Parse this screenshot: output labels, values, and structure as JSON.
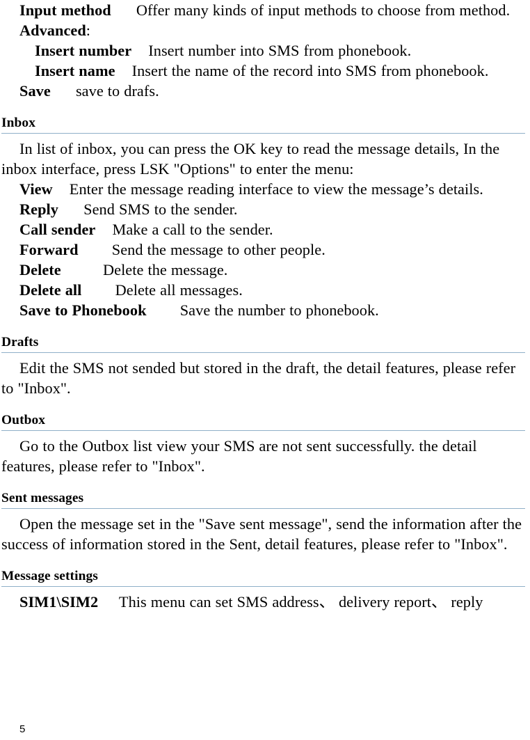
{
  "document": {
    "page_number": "5",
    "rule_color": "#8FAFC8",
    "sections": [
      {
        "id": "compose-options",
        "heading": null,
        "lines": [
          {
            "indent": "indent1",
            "term": "Input method",
            "gap": "      ",
            "text": "Offer many kinds of input methods to choose from method."
          },
          {
            "indent": "indent1",
            "term": "Advanced",
            "gap": "",
            "text": ":"
          },
          {
            "indent": "indent2",
            "term": "Insert number",
            "gap": "    ",
            "text": "Insert number into SMS from phonebook."
          },
          {
            "indent": "indent2",
            "term": "Insert name",
            "gap": "    ",
            "text": "Insert the name of the record into SMS from phonebook."
          },
          {
            "indent": "indent1",
            "term": "Save",
            "gap": "      ",
            "text": "save to drafs."
          }
        ]
      },
      {
        "id": "inbox",
        "heading": "Inbox",
        "lines": [
          {
            "indent": "indent1",
            "term": "",
            "gap": "",
            "text": "In list of inbox, you can press the OK key to read the message details, In the inbox interface, press LSK \"Options\" to enter the menu:"
          },
          {
            "indent": "indent1",
            "term": "View",
            "gap": "    ",
            "text": "Enter the message reading interface to view the message’s details."
          },
          {
            "indent": "indent1",
            "term": "Reply",
            "gap": "      ",
            "text": "Send SMS to the sender."
          },
          {
            "indent": "indent1",
            "term": "Call sender",
            "gap": "    ",
            "text": "Make a call to the sender."
          },
          {
            "indent": "indent1",
            "term": "Forward",
            "gap": "        ",
            "text": "Send the message to other people."
          },
          {
            "indent": "indent1",
            "term": "Delete",
            "gap": "          ",
            "text": "Delete the message."
          },
          {
            "indent": "indent1",
            "term": "Delete all",
            "gap": "        ",
            "text": "Delete all messages."
          },
          {
            "indent": "indent1",
            "term": "Save to Phonebook",
            "gap": "        ",
            "text": "Save the number to phonebook."
          }
        ]
      },
      {
        "id": "drafts",
        "heading": "Drafts",
        "lines": [
          {
            "indent": "indent1",
            "term": "",
            "gap": "",
            "text": "Edit the SMS not sended but stored in the draft, the detail features, please refer to \"Inbox\"."
          }
        ]
      },
      {
        "id": "outbox",
        "heading": "Outbox",
        "lines": [
          {
            "indent": "indent1",
            "term": "",
            "gap": "",
            "text": "Go to the Outbox list view your SMS are not sent successfully. the detail features, please refer to \"Inbox\"."
          }
        ]
      },
      {
        "id": "sent-messages",
        "heading": "Sent messages",
        "lines": [
          {
            "indent": "indent1",
            "term": "",
            "gap": "",
            "text": "Open the message set in the \"Save sent message\", send the information after the success of information stored in the Sent, detail features, please refer to \"Inbox\"."
          }
        ]
      },
      {
        "id": "message-settings",
        "heading": "Message settings",
        "lines": [
          {
            "indent": "indent1",
            "term": "SIM1\\SIM2",
            "gap": "     ",
            "text": "This menu can set SMS address、 delivery report、 reply"
          }
        ]
      }
    ]
  }
}
